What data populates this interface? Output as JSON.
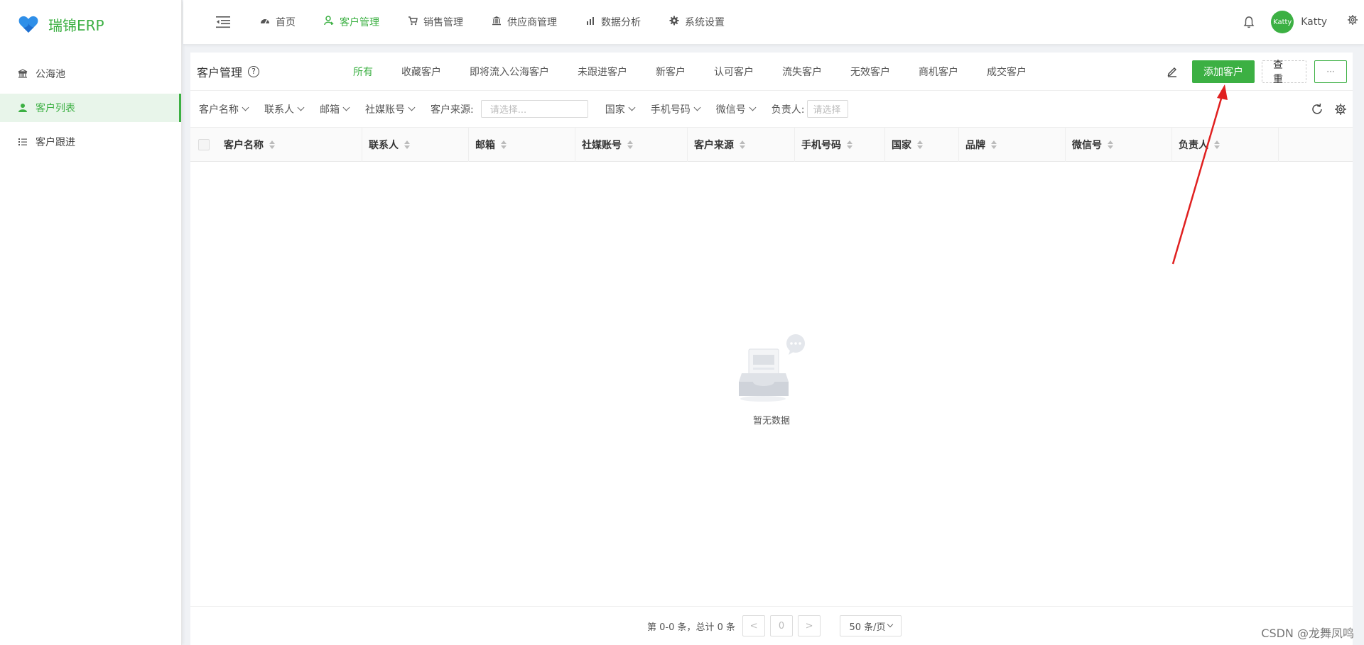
{
  "app": {
    "title": "瑞锦ERP"
  },
  "sidebar": {
    "items": [
      {
        "label": "公海池",
        "icon": "bank-icon"
      },
      {
        "label": "客户列表",
        "icon": "user-icon",
        "active": true
      },
      {
        "label": "客户跟进",
        "icon": "list-icon"
      }
    ]
  },
  "topnav": {
    "items": [
      {
        "label": "首页",
        "icon": "dashboard-icon"
      },
      {
        "label": "客户管理",
        "icon": "customer-icon",
        "active": true
      },
      {
        "label": "销售管理",
        "icon": "cart-icon"
      },
      {
        "label": "供应商管理",
        "icon": "bank-icon"
      },
      {
        "label": "数据分析",
        "icon": "chart-icon"
      },
      {
        "label": "系统设置",
        "icon": "gear-icon"
      }
    ]
  },
  "user": {
    "avatar_text": "Katty",
    "name": "Katty"
  },
  "panel": {
    "title": "客户管理",
    "help_glyph": "?",
    "subtabs": [
      "所有",
      "收藏客户",
      "即将流入公海客户",
      "未跟进客户",
      "新客户",
      "认可客户",
      "流失客户",
      "无效客户",
      "商机客户",
      "成交客户"
    ],
    "add_label": "添加客户",
    "reset_label": "查重",
    "more_label": "···"
  },
  "filters": {
    "customer_name": "客户名称",
    "contact": "联系人",
    "email": "邮箱",
    "social": "社媒账号",
    "source_label": "客户来源:",
    "source_placeholder": "请选择...",
    "country": "国家",
    "phone": "手机号码",
    "wechat": "微信号",
    "owner_label": "负责人:",
    "owner_placeholder": "请选择"
  },
  "table": {
    "columns": [
      "客户名称",
      "联系人",
      "邮箱",
      "社媒账号",
      "客户来源",
      "手机号码",
      "国家",
      "品牌",
      "微信号",
      "负责人"
    ],
    "empty_text": "暂无数据"
  },
  "pager": {
    "total_text": "第 0-0 条，总计 0 条",
    "prev": "<",
    "page": "0",
    "next": ">",
    "size": "50 条/页"
  },
  "watermark": "CSDN @龙舞凤鸣",
  "colors": {
    "accent": "#3cb043",
    "annotation_arrow": "#e02020"
  }
}
